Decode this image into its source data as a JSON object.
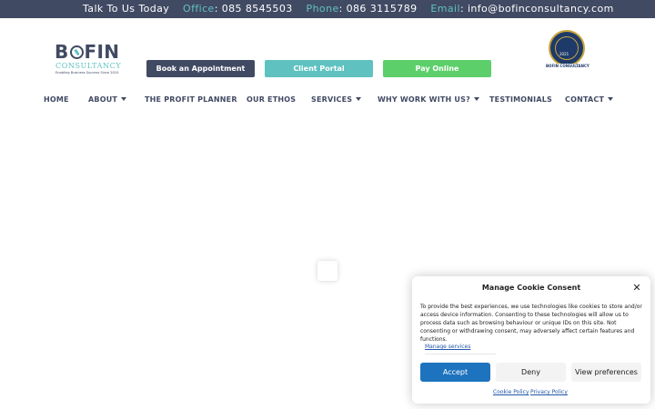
{
  "topbar": {
    "talk": "Talk To Us Today",
    "office_label": "Office",
    "office_number": ": 085 8545503",
    "phone_label": "Phone",
    "phone_number": ": 086 3115789",
    "email_label": "Email",
    "email_address": ": info@bofinconsultancy.com"
  },
  "logo": {
    "word_b": "B",
    "word_fin": "FIN",
    "sub": "CONSULTANCY",
    "tagline": "Enabling Business Success Since 2010"
  },
  "buttons": {
    "book": "Book an Appointment",
    "portal": "Client Portal",
    "pay": "Pay Online"
  },
  "badge": {
    "year": "2021",
    "label": "BOFIN CONSULTANCY"
  },
  "nav": {
    "home": "HOME",
    "about": "ABOUT",
    "profit_planner": "THE PROFIT PLANNER",
    "ethos": "OUR ETHOS",
    "services": "SERVICES",
    "why": "WHY WORK WITH US?",
    "testimonials": "TESTIMONIALS",
    "contact": "CONTACT"
  },
  "cookie": {
    "title": "Manage Cookie Consent",
    "text": "To provide the best experiences, we use technologies like cookies to store and/or access device information. Consenting to these technologies will allow us to process data such as browsing behaviour or unique IDs on this site. Not consenting or withdrawing consent, may adversely affect certain features and functions.",
    "manage": "Manage services",
    "accept": "Accept",
    "deny": "Deny",
    "preferences": "View preferences",
    "cookie_policy": "Cookie Policy",
    "privacy_policy": "Privacy Policy"
  },
  "colors": {
    "navy": "#414a63",
    "teal": "#5fc2c0",
    "green": "#5ccf6b",
    "accept_blue": "#1e73be"
  },
  "icons": {
    "close": "close-icon",
    "dropdown": "chevron-down-icon"
  }
}
